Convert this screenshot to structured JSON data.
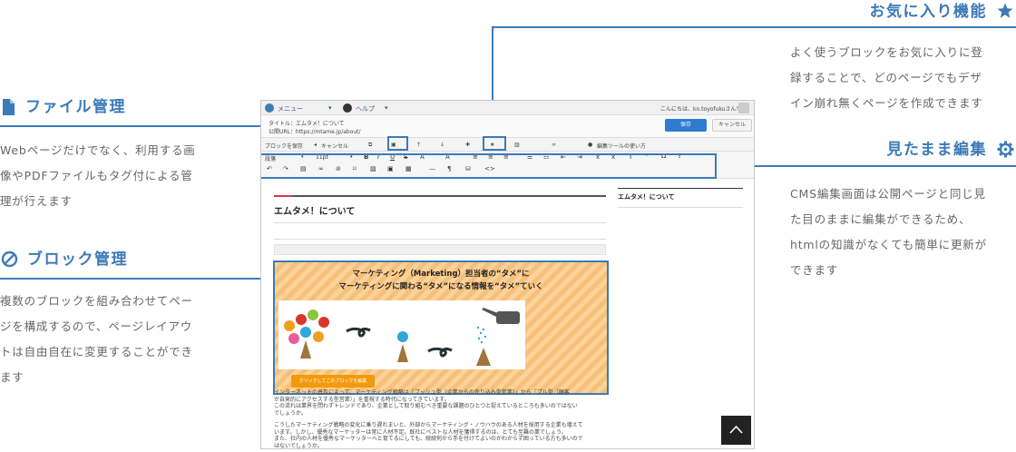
{
  "features": {
    "file": {
      "title": "ファイル管理",
      "icon": "document-icon",
      "desc_lines": [
        "Webページだけでなく、利用する画",
        "像やPDFファイルもタグ付による管",
        "理が行えます"
      ]
    },
    "block": {
      "title": "ブロック管理",
      "icon": "prohibit-icon",
      "desc_lines": [
        "複数のブロックを組み合わせてペー",
        "ジを構成するので、ページレイアウ",
        "トは自由自在に変更することができ",
        "ます"
      ]
    },
    "favorite": {
      "title": "お気に入り機能",
      "icon": "star-icon",
      "desc_lines": [
        "よく使うブロックをお気に入りに登",
        "録することで、どのページでもデザ",
        "イン崩れ無くページを作成できます"
      ]
    },
    "wysiwyg": {
      "title": "見たまま編集",
      "icon": "gear-icon",
      "desc_lines": [
        "CMS編集画面は公開ページと同じ見",
        "た目のままに編集ができるため、",
        "htmlの知識がなくても簡単に更新が",
        "できます"
      ]
    }
  },
  "screenshot": {
    "menu_label": "メニュー",
    "help_label": "ヘルプ",
    "greeting": "こんにちは、kn.toyofukuさん！",
    "title_line": "タイトル：エムタメ！について",
    "url_line": "公開URL：https://mtame.jp/about/",
    "save_label": "保存",
    "cancel_label": "キャンセル",
    "toolbar": {
      "block_save": "ブロックを保存",
      "cancel": "キャンセル",
      "edit_tool_help": "編集ツールの使い方"
    },
    "editor": {
      "format_select": "段落",
      "size_select": "11pt"
    },
    "article_title": "エムタメ！について",
    "sidebar_title": "エムタメ！について",
    "block_headline_1": "マーケティング（Marketing）担当者の“タメ”に",
    "block_headline_2": "マーケティングに関わる“タメ”になる情報を“タメ”ていく",
    "block_button": "クリックしてこのブロックを編集",
    "paragraphs": [
      "インターネットの普及によって、マーケティング戦略は「プッシュ型（企業からの売り込み型営業）」から「プル型（顧客",
      "が自発的にアクセスする型営業）」を重視する時代になってきています。",
      "この流れは業界を問わずトレンドであり、企業として取り組むべき重要な課題のひとつと捉えているところも多いのではない",
      "でしょうか。",
      "こうしたマーケティング戦略の変化に乗り遅れまいと、外部からマーケティング・ノウハウのある人材を採用する企業も増えて",
      "います。しかし、優秀なマーケッターは常に人材不足。既社にベストな人材を獲得するのは、とても至難の業でしょう。",
      "また、社内の人材を優秀なマーケッターへと育てるにしても、続続何から手を付けてよいのかわからず困っている方も多いので",
      "はないでしょうか。"
    ]
  },
  "colors": {
    "accent": "#3d7ab8",
    "save_button": "#2e7bcf",
    "block_button": "#f29a0c",
    "highlight_red": "#e0301e"
  }
}
